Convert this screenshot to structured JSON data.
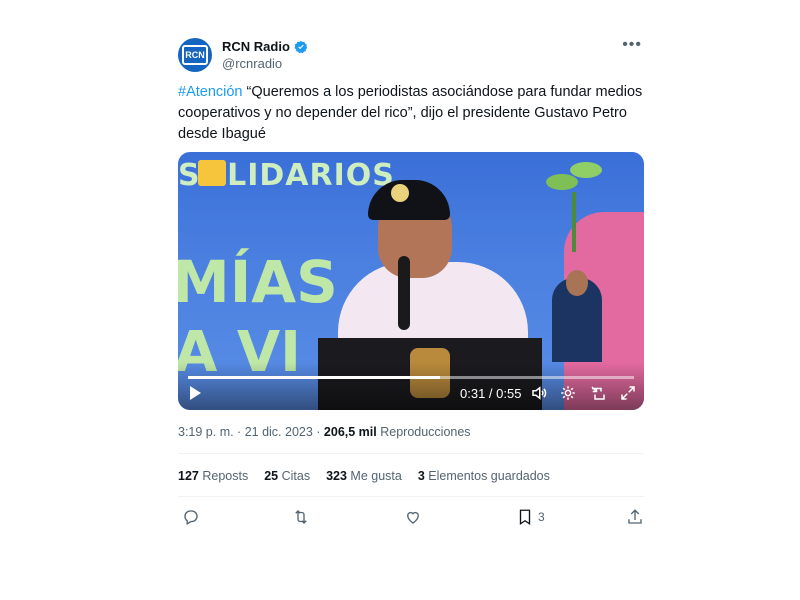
{
  "author": {
    "display_name": "RCN Radio",
    "handle": "@rcnradio",
    "avatar_icon": "rcn-logo",
    "avatar_text": "RCN"
  },
  "post": {
    "hashtag": "#Atención",
    "body": " “Queremos a los periodistas asociándose para fundar medios cooperativos y no depender del rico”, dijo el presidente Gustavo Petro desde Ibagué"
  },
  "video": {
    "time_display": "0:31 / 0:55",
    "progress": 0.564,
    "banner_text_top": "SOLIDARIOS",
    "banner_text_mid": "MÍAS",
    "banner_text_bot": "A VI"
  },
  "meta": {
    "timestamp": "3:19 p. m. · 21 dic. 2023",
    "separator": " · ",
    "views_value": "206,5 mil",
    "views_label": " Reproducciones"
  },
  "stats": {
    "reposts_value": "127",
    "reposts_label": "Reposts",
    "quotes_value": "25",
    "quotes_label": "Citas",
    "likes_value": "323",
    "likes_label": "Me gusta",
    "bookmarks_value": "3",
    "bookmarks_label": "Elementos guardados"
  },
  "actions": {
    "bookmark_count": "3"
  },
  "colors": {
    "accent": "#1d9bf0",
    "secondary_text": "#536471"
  }
}
